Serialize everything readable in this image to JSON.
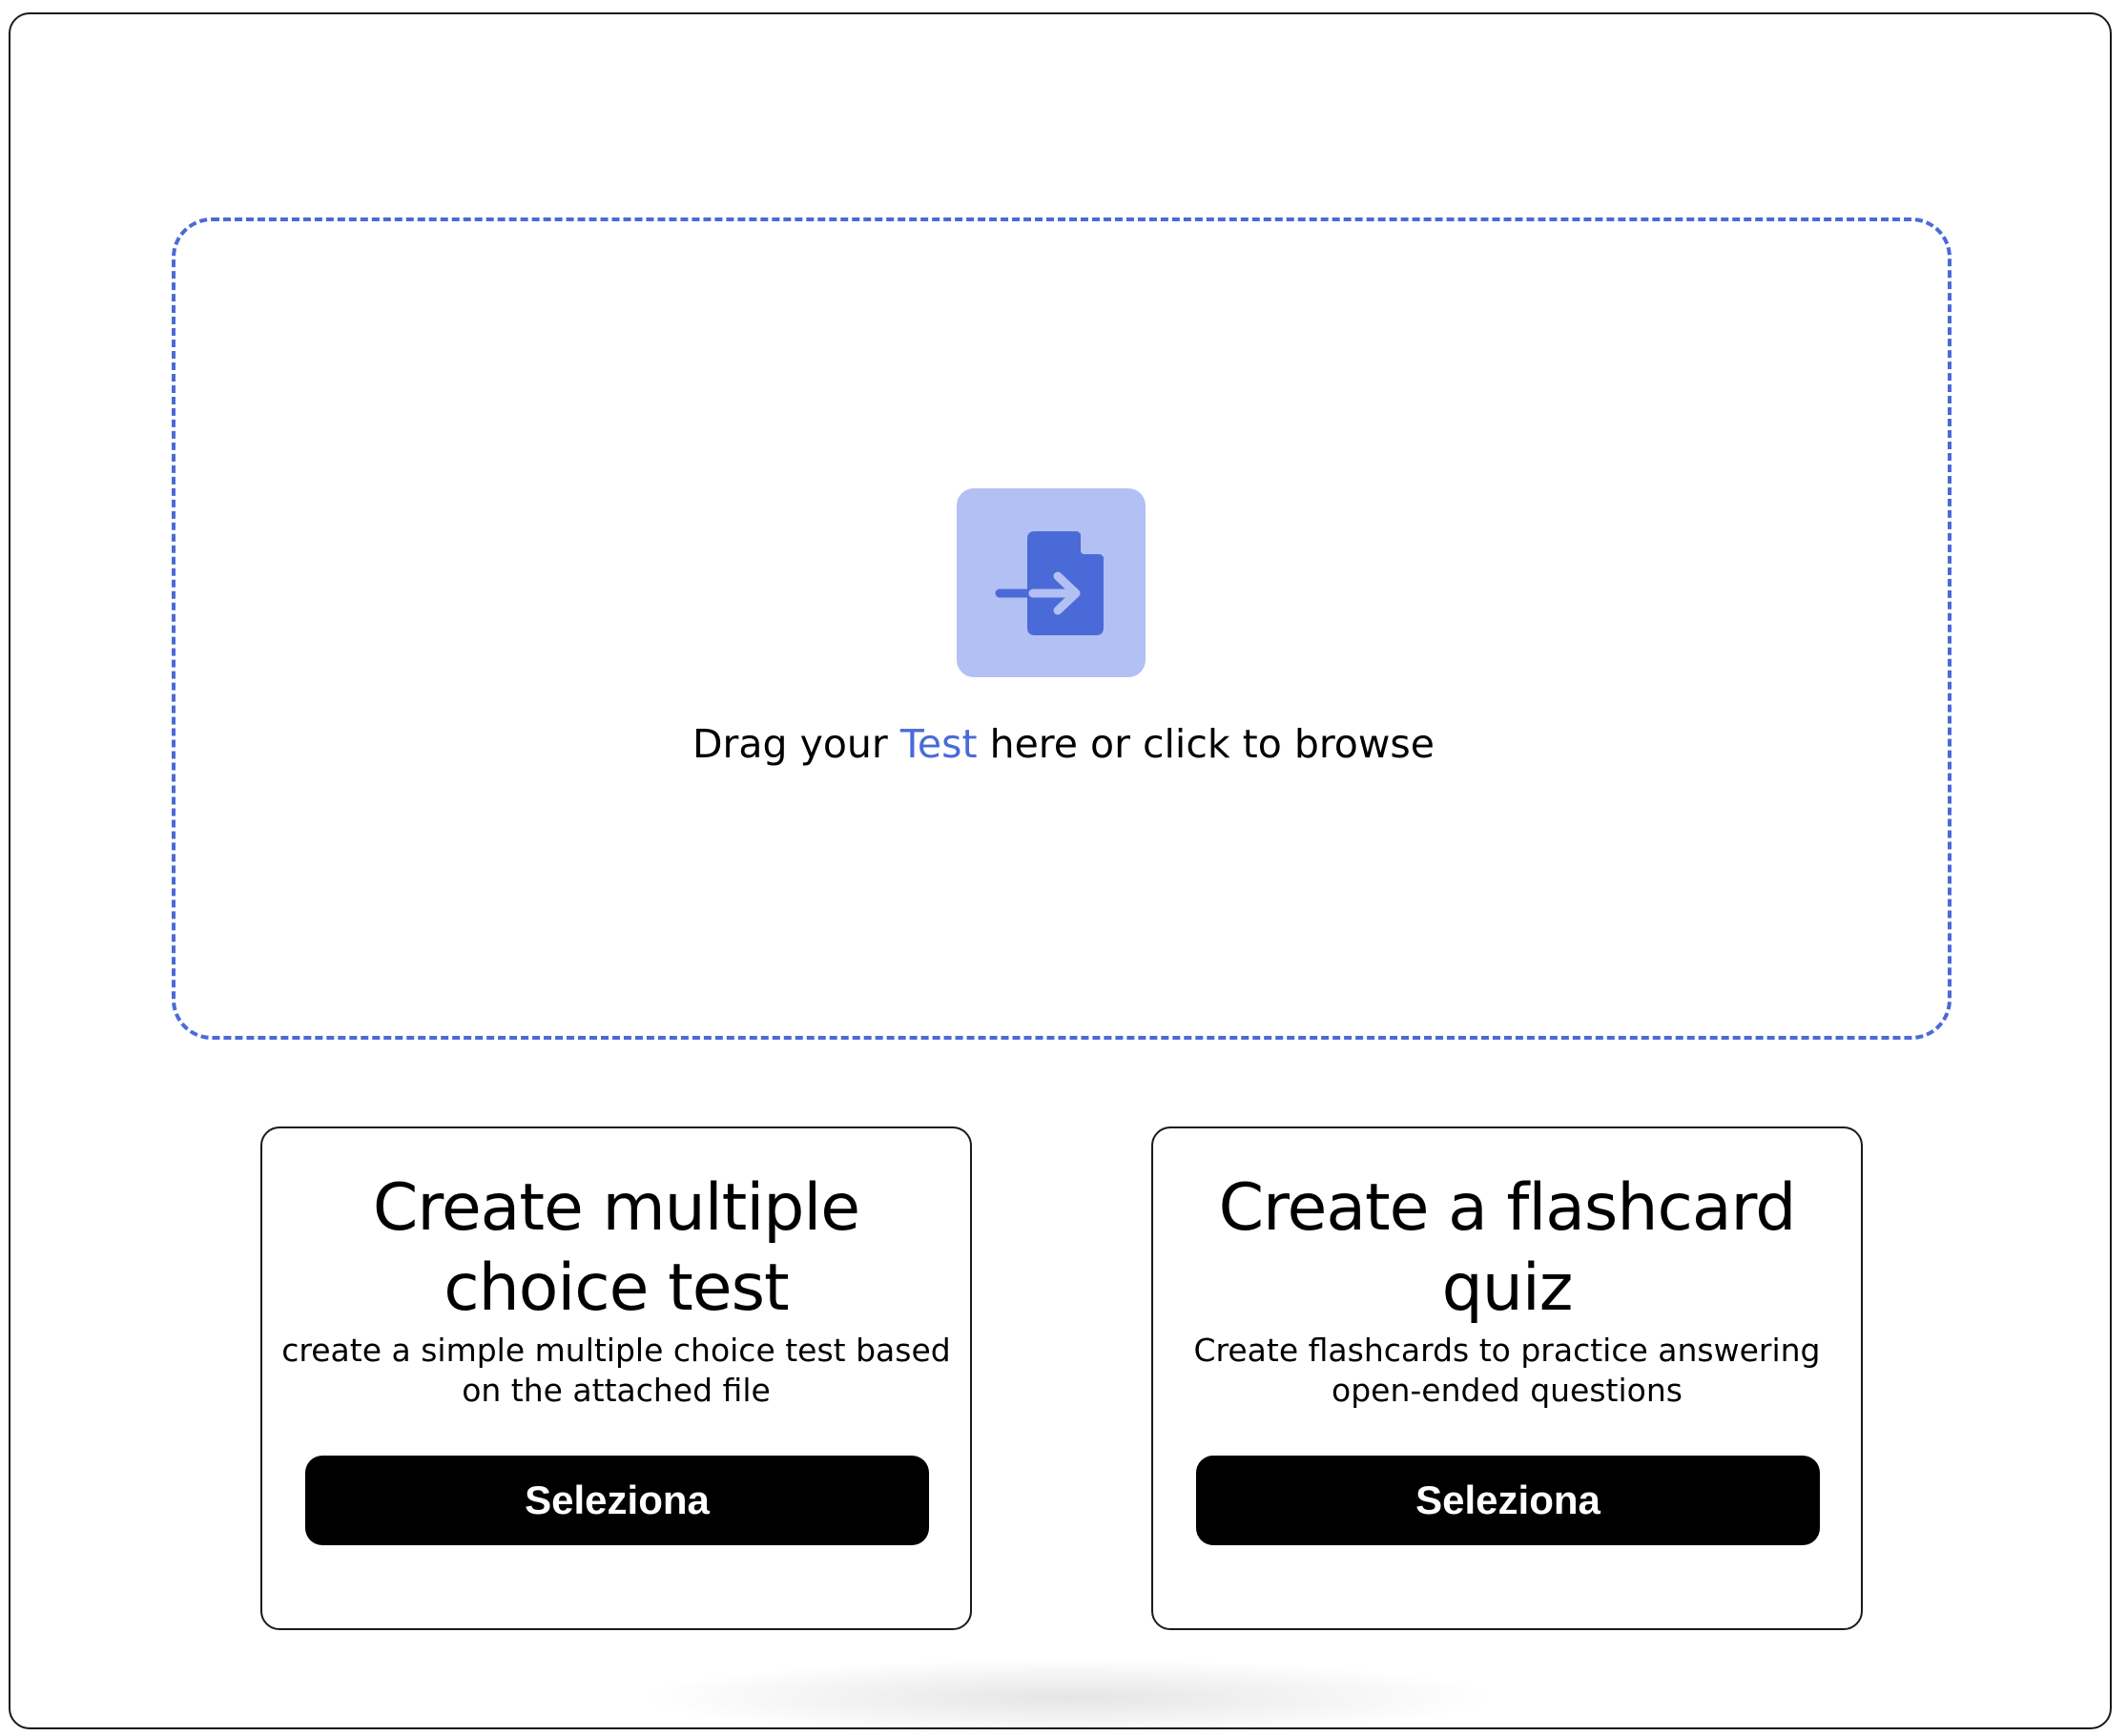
{
  "dropzone": {
    "text_before": "Drag your ",
    "text_accent": "Test",
    "text_after": " here or click to browse",
    "icon": "file-import-icon",
    "accent_color": "#4a6ad8",
    "icon_tile_color": "#b3c0f3"
  },
  "cards": [
    {
      "title": "Create multiple choice test",
      "description": "create a simple multiple choice test based on the attached file",
      "button_label": "Seleziona"
    },
    {
      "title": "Create a flashcard quiz",
      "description": "Create flashcards to practice answering open-ended questions",
      "button_label": "Seleziona"
    }
  ]
}
